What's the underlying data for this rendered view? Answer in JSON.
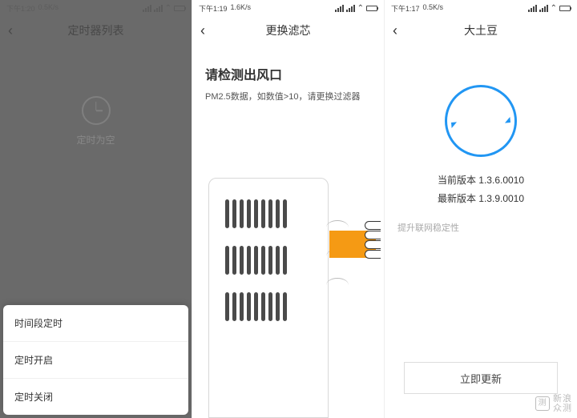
{
  "pane1": {
    "status": {
      "time": "下午1:20",
      "net": "0.5K/s"
    },
    "title": "定时器列表",
    "empty": "定时为空",
    "sheet": [
      "时间段定时",
      "定时开启",
      "定时关闭"
    ]
  },
  "pane2": {
    "status": {
      "time": "下午1:19",
      "net": "1.6K/s"
    },
    "title": "更换滤芯",
    "heading": "请检测出风口",
    "sub": "PM2.5数据，如数值>10，请更换过滤器"
  },
  "pane3": {
    "status": {
      "time": "下午1:17",
      "net": "0.5K/s"
    },
    "title": "大土豆",
    "current_label": "当前版本 1.3.6.0010",
    "latest_label": "最新版本 1.3.9.0010",
    "note": "提升联网稳定性",
    "button": "立即更新"
  },
  "watermark": {
    "brand": "新浪",
    "sub": "众测"
  }
}
